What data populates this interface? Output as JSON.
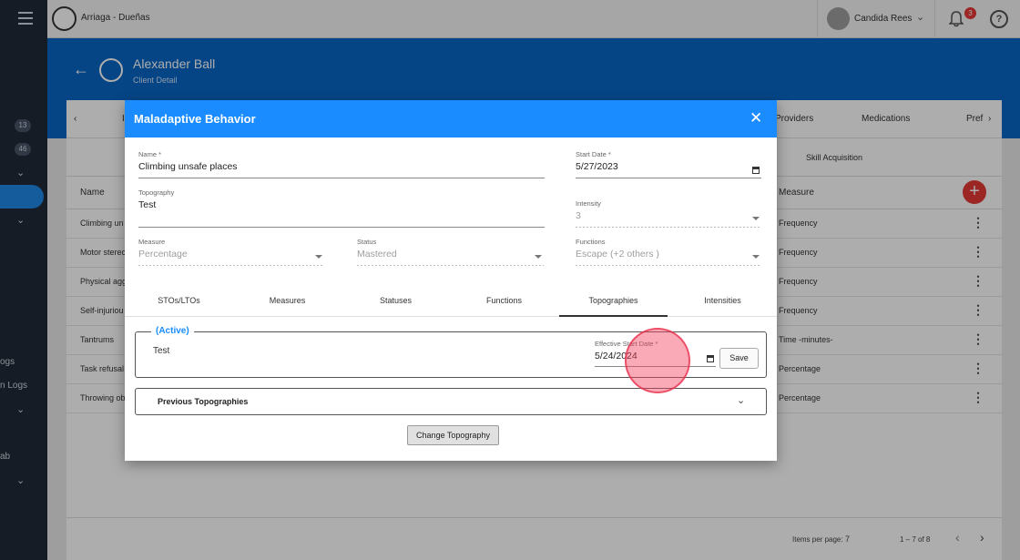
{
  "nav": {
    "badges": [
      "13",
      "46"
    ],
    "truncated_labels": [
      "ogs",
      "n Logs",
      "ab"
    ]
  },
  "topbar": {
    "org_name": "Arriaga - Dueñas",
    "user_name": "Candida Rees",
    "notification_count": "3",
    "help_symbol": "?"
  },
  "client": {
    "name": "Alexander Ball",
    "subtitle": "Client Detail"
  },
  "background": {
    "tabs": [
      "Providers",
      "Medications",
      "Pref"
    ],
    "tab_partial": "I",
    "sub_tab": "Skill Acquisition",
    "table_headers": {
      "name": "Name",
      "measure": "Measure"
    },
    "rows": [
      {
        "name": "Climbing un",
        "measure": "Frequency"
      },
      {
        "name": "Motor sterec",
        "measure": "Frequency"
      },
      {
        "name": "Physical agg",
        "measure": "Frequency"
      },
      {
        "name": "Self-injuriou",
        "measure": "Frequency"
      },
      {
        "name": "Tantrums",
        "measure": "Time -minutes-"
      },
      {
        "name": "Task refusal",
        "measure": "Percentage"
      },
      {
        "name": "Throwing ob",
        "measure": "Percentage"
      }
    ],
    "footer": {
      "items_per_page_label": "Items per page:",
      "items_per_page": "7",
      "range": "1 – 7 of 8"
    }
  },
  "modal": {
    "title": "Maladaptive Behavior",
    "fields": {
      "name": {
        "label": "Name *",
        "value": "Climbing unsafe places"
      },
      "start_date": {
        "label": "Start Date *",
        "value": "5/27/2023"
      },
      "topography": {
        "label": "Topography",
        "value": "Test"
      },
      "intensity": {
        "label": "Intensity",
        "value": "3"
      },
      "measure": {
        "label": "Measure",
        "value": "Percentage"
      },
      "status": {
        "label": "Status",
        "value": "Mastered"
      },
      "functions": {
        "label": "Functions",
        "value": "Escape (+2 others )"
      }
    },
    "tabs": [
      "STOs/LTOs",
      "Measures",
      "Statuses",
      "Functions",
      "Topographies",
      "Intensities"
    ],
    "active_tab": "Topographies",
    "active_section": {
      "legend": "(Active)",
      "text": "Test",
      "effective_start_label": "Effective Start Date *",
      "effective_start_value": "5/24/2024",
      "save_label": "Save"
    },
    "previous_label": "Previous Topographies",
    "change_button": "Change Topography"
  }
}
